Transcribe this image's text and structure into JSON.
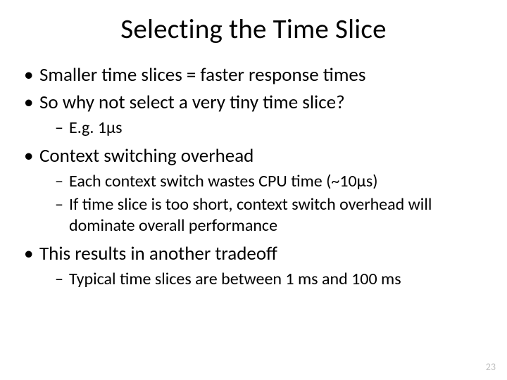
{
  "title": "Selecting the Time Slice",
  "bullets": {
    "b1": "Smaller time slices = faster response times",
    "b2": "So why not select a very tiny time slice?",
    "b2_sub": {
      "s1": "E.g. 1μs"
    },
    "b3": "Context switching overhead",
    "b3_sub": {
      "s1": "Each context switch wastes CPU time (~10μs)",
      "s2": "If time slice is too short, context switch overhead will dominate overall performance"
    },
    "b4": "This results in another tradeoff",
    "b4_sub": {
      "s1": "Typical time slices are between 1 ms and 100 ms"
    }
  },
  "page_number": "23"
}
